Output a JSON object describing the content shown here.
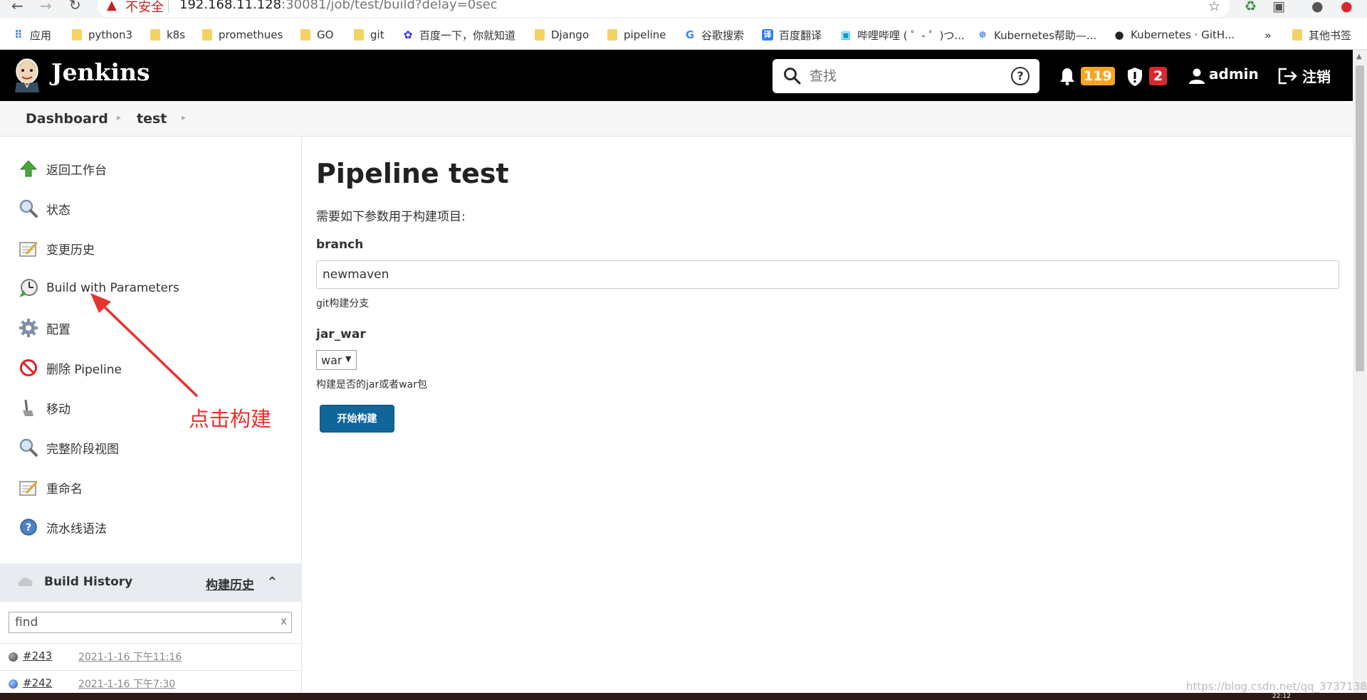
{
  "browser": {
    "security_label": "不安全",
    "url_host": "192.168.11.128",
    "url_rest": ":30081/job/test/build?delay=0sec",
    "bookmarks": [
      {
        "label": "应用"
      },
      {
        "label": "python3"
      },
      {
        "label": "k8s"
      },
      {
        "label": "promethues"
      },
      {
        "label": "GO"
      },
      {
        "label": "git"
      },
      {
        "label": "百度一下，你就知道"
      },
      {
        "label": "Django"
      },
      {
        "label": "pipeline"
      },
      {
        "label": "谷歌搜索"
      },
      {
        "label": "百度翻译"
      },
      {
        "label": "哔哩哔哩 ( ゜- ゜)つ..."
      },
      {
        "label": "Kubernetes帮助—..."
      },
      {
        "label": "Kubernetes · GitH..."
      },
      {
        "label": "其他书签"
      }
    ],
    "more": "»"
  },
  "header": {
    "brand": "Jenkins",
    "search_placeholder": "查找",
    "notifications": "119",
    "security_count": "2",
    "user": "admin",
    "logout": "注销",
    "help_glyph": "?"
  },
  "breadcrumb": {
    "items": [
      "Dashboard",
      "test"
    ]
  },
  "sidebar": {
    "tasks": [
      {
        "label": "返回工作台"
      },
      {
        "label": "状态"
      },
      {
        "label": "变更历史"
      },
      {
        "label": "Build with Parameters"
      },
      {
        "label": "配置"
      },
      {
        "label": "删除 Pipeline"
      },
      {
        "label": "移动"
      },
      {
        "label": "完整阶段视图"
      },
      {
        "label": "重命名"
      },
      {
        "label": "流水线语法"
      }
    ]
  },
  "build_history": {
    "title": "Build History",
    "link": "构建历史",
    "filter_value": "find",
    "clear": "x",
    "builds": [
      {
        "number": "#243",
        "date": "2021-1-16 下午11:16"
      },
      {
        "number": "#242",
        "date": "2021-1-16 下午7:30"
      }
    ]
  },
  "main": {
    "title": "Pipeline test",
    "description": "需要如下参数用于构建项目:",
    "params": [
      {
        "name": "branch",
        "value": "newmaven",
        "help": "git构建分支"
      },
      {
        "name": "jar_war",
        "value": "war",
        "help": "构建是否的jar或者war包"
      }
    ],
    "build_button": "开始构建"
  },
  "annotation": {
    "text": "点击构建",
    "color": "#e8322f"
  },
  "colors": {
    "header_bg": "#000000",
    "notify_badge": "#f5a623",
    "security_badge": "#d9282f",
    "build_button": "#10669b"
  },
  "watermark": "https://blog.csdn.net/qq_3737138",
  "clock": "22:12"
}
